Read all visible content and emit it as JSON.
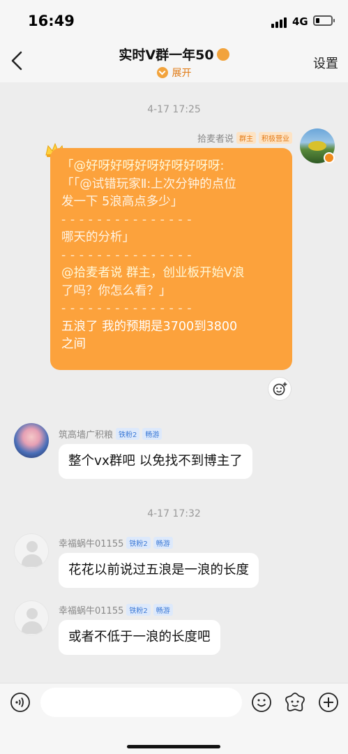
{
  "status_bar": {
    "time": "16:49",
    "network": "4G",
    "battery_level": 0.2
  },
  "header": {
    "title": "实时Ⅴ群一年50",
    "expand_label": "展开",
    "settings_label": "设置"
  },
  "messages": {
    "timestamp_1": "4-17 17:25",
    "owner": {
      "name": "拾麦者说",
      "tags": [
        "群主",
        "积极营业"
      ],
      "lines": [
        "「@好呀好呀好呀好呀好呀呀:",
        "「「@试错玩家Ⅱ:上次分钟的点位",
        "发一下  5浪高点多少」",
        "- - - - - - - - - - - - - - -",
        "哪天的分析」",
        "- - - - - - - - - - - - - - -",
        "@拾麦者说 群主，创业板开始Ⅴ浪",
        "了吗？你怎么看？」",
        "- - - - - - - - - - - - - - -",
        "五浪了 我的预期是3700到3800",
        "之间"
      ]
    },
    "msg2": {
      "name": "筑高墙广积粮",
      "tags": [
        "铁粉2",
        "畅游"
      ],
      "text": "整个vx群吧 以免找不到博主了"
    },
    "timestamp_2": "4-17 17:32",
    "msg3": {
      "name": "幸福蜗牛01155",
      "tags": [
        "铁粉2",
        "畅游"
      ],
      "text": "花花以前说过五浪是一浪的长度"
    },
    "msg4": {
      "name": "幸福蜗牛01155",
      "tags": [
        "铁粉2",
        "畅游"
      ],
      "text": "或者不低于一浪的长度吧"
    }
  },
  "input": {
    "placeholder": ""
  },
  "colors": {
    "bubble_orange": "#fca23c",
    "accent": "#e07a14",
    "background": "#ededed"
  }
}
